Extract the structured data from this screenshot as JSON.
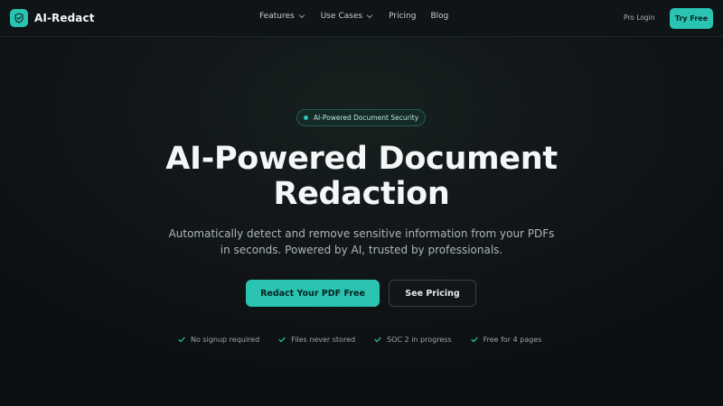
{
  "nav": {
    "brand": "AI-Redact",
    "brand_icon": "shield-check-icon",
    "links": [
      {
        "label": "Features",
        "has_dropdown": true
      },
      {
        "label": "Use Cases",
        "has_dropdown": true
      },
      {
        "label": "Pricing",
        "has_dropdown": false
      },
      {
        "label": "Blog",
        "has_dropdown": false
      }
    ],
    "pro_login": "Pro Login",
    "try_free": "Try Free"
  },
  "hero": {
    "badge": "AI-Powered Document Security",
    "headline_line1": "AI-Powered Document",
    "headline_line2": "Redaction",
    "subtitle_line1": "Automatically detect and remove sensitive information from your PDFs",
    "subtitle_line2": "in seconds. Powered by AI, trusted by professionals.",
    "cta_primary": "Redact Your PDF Free",
    "cta_secondary": "See Pricing",
    "features": [
      "No signup required",
      "Files never stored",
      "SOC 2 in progress",
      "Free for 4 pages"
    ]
  },
  "colors": {
    "accent": "#2bc3b1",
    "background": "#0d1114",
    "nav_background": "#0f1416"
  }
}
